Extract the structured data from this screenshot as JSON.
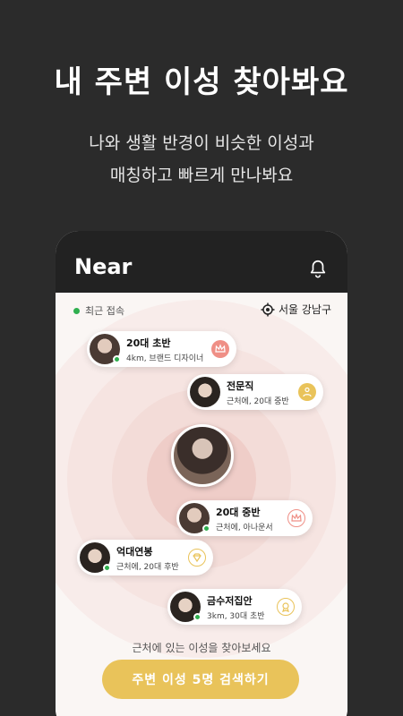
{
  "headline": "내 주변 이성 찾아봐요",
  "subline1": "나와 생활 반경이 비슷한 이성과",
  "subline2": "매칭하고 빠르게 만나봐요",
  "app": {
    "title": "Near",
    "recent_label": "최근 접속",
    "location": "서울 강남구",
    "hint": "근처에 있는 이성을 찾아보세요",
    "cta": "주변 이성 5명 검색하기"
  },
  "cards": [
    {
      "title": "20대 초반",
      "detail": "4km, 브랜드 디자이너",
      "badge": "crown-icon",
      "badge_color": "#ef8f86"
    },
    {
      "title": "전문직",
      "detail": "근처에, 20대 중반",
      "badge": "person-icon",
      "badge_color": "#e9c35a"
    },
    {
      "title": "20대 중반",
      "detail": "근처에, 아나운서",
      "badge": "crown-icon",
      "badge_color": "#ef8f86"
    },
    {
      "title": "억대연봉",
      "detail": "근처에, 20대 후반",
      "badge": "diamond-icon",
      "badge_color": "#e9c35a"
    },
    {
      "title": "금수저집안",
      "detail": "3km, 30대 초반",
      "badge": "medal-icon",
      "badge_color": "#e9c35a"
    }
  ],
  "colors": {
    "background": "#2b2b2b",
    "accent": "#e9c35a",
    "online": "#2faf4f",
    "crown": "#ef8f86"
  }
}
